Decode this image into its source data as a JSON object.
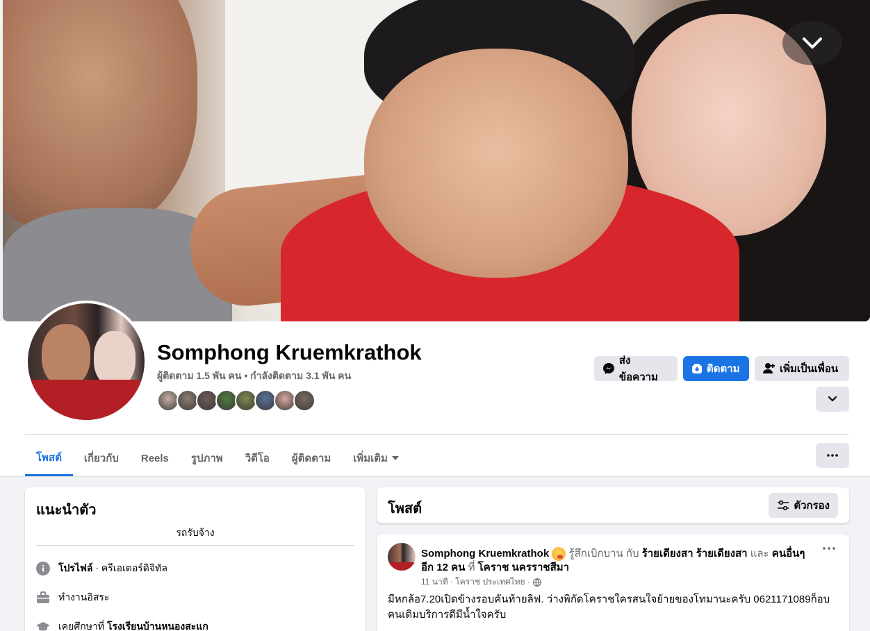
{
  "profile": {
    "name": "Somphong Kruemkrathok",
    "followers": "ผู้ติดตาม 1.5 พัน คน • กำลังติดตาม 3.1 พัน คน",
    "friend_avatar_colors": [
      "#c9b1a5",
      "#8e7d72",
      "#6b5a55",
      "#4f7a3c",
      "#7d8a4a",
      "#5a6f9a",
      "#d9a9a2",
      "#7a6a60"
    ]
  },
  "actions": {
    "message_label": "ส่งข้อความ",
    "follow_label": "ติดตาม",
    "add_friend_label": "เพิ่มเป็นเพื่อน"
  },
  "tabs": [
    {
      "label": "โพสต์",
      "active": true
    },
    {
      "label": "เกี่ยวกับ"
    },
    {
      "label": "Reels"
    },
    {
      "label": "รูปภาพ"
    },
    {
      "label": "วิดีโอ"
    },
    {
      "label": "ผู้ติดตาม"
    },
    {
      "label": "เพิ่มเติม"
    }
  ],
  "intro": {
    "title": "แนะนำตัว",
    "bio": "รถรับจ้าง",
    "profile_label": "โปรไฟล์",
    "profile_category": " · ครีเอเตอร์ดิจิทัล",
    "work": "ทำงานอิสระ",
    "school_prefix": "เคยศึกษาที่ ",
    "school_name": "โรงเรียนบ้านหนองสะแก"
  },
  "posts": {
    "title": "โพสต์",
    "filter_label": "ตัวกรอง"
  },
  "post": {
    "author": "Somphong Kruemkrathok",
    "feeling": " รู้สึกเบิกบาน กับ ",
    "tagged": "ร้ายเดียงสา ร้ายเดียงสา",
    "and": " และ ",
    "others": "คนอื่นๆ อีก 12 คน",
    "at": "ที่ ",
    "location": "โคราช นครราชสีมา",
    "time": "11 นาที · โคราช ประเทศไทย ·",
    "body": "มีหกล้อ7.20เปิดข้างรอบคันท้ายลิฟ. ว่างพิกัดโคราชใครสนใจย้ายของโทมานะครับ 0621171089ก็อบคนเดิมบริการดีมีน้ำใจครับ"
  },
  "colors": {
    "accent": "#1b74e4",
    "page_bg": "#f0f2f5",
    "muted_text": "#65676b"
  }
}
